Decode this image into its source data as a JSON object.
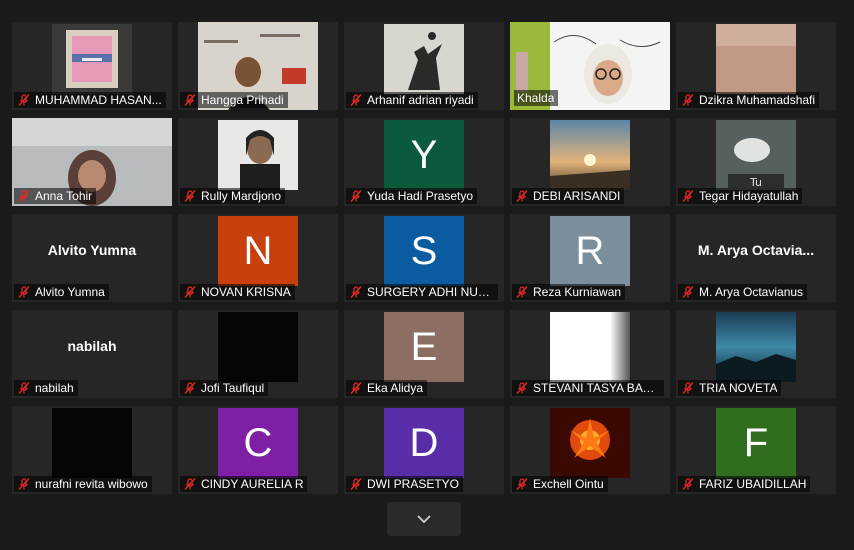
{
  "colors": {
    "background": "#1a1a1a",
    "tile": "#262626",
    "active_speaker_border": "#e4f08a",
    "muted_icon": "#e02828"
  },
  "participants": [
    {
      "name": "MUHAMMAD HASAN...",
      "muted": true,
      "media": "photo-art-icon"
    },
    {
      "name": "Hangga Prihadi",
      "muted": true,
      "media": "camera-video-icon"
    },
    {
      "name": "Arhanif adrian riyadi",
      "muted": true,
      "media": "photo-bird-icon"
    },
    {
      "name": "Khalda",
      "muted": false,
      "media": "camera-video-icon",
      "active": true
    },
    {
      "name": "Dzikra Muhamadshafi",
      "muted": true,
      "media": "blurred-photo-icon"
    },
    {
      "name": "Anna Tohir",
      "muted": true,
      "media": "camera-video-icon"
    },
    {
      "name": "Rully Mardjono",
      "muted": true,
      "media": "photo-portrait-icon"
    },
    {
      "name": "Yuda Hadi Prasetyo",
      "muted": true,
      "avatar_letter": "Y",
      "avatar_color": "#0c5a3c"
    },
    {
      "name": "DEBI ARISANDI",
      "muted": true,
      "media": "photo-sunset-icon"
    },
    {
      "name": "Tegar Hidayatullah",
      "muted": true,
      "media": "photo-anime-icon"
    },
    {
      "name": "Alvito Yumna",
      "muted": true,
      "center_name": "Alvito Yumna"
    },
    {
      "name": "NOVAN KRISNA",
      "muted": true,
      "avatar_letter": "N",
      "avatar_color": "#c8400c"
    },
    {
      "name": "SURGERY ADHI NUG...",
      "muted": true,
      "avatar_letter": "S",
      "avatar_color": "#0a5ba0"
    },
    {
      "name": "Reza Kurniawan",
      "muted": true,
      "avatar_letter": "R",
      "avatar_color": "#7a8e9b"
    },
    {
      "name": "M. Arya Octavianus",
      "muted": true,
      "center_name": "M. Arya Octavia..."
    },
    {
      "name": "nabilah",
      "muted": true,
      "center_name": "nabilah"
    },
    {
      "name": "Jofi Taufiqul",
      "muted": true,
      "media": "camera-off-black-icon"
    },
    {
      "name": "Eka Alidya",
      "muted": true,
      "avatar_letter": "E",
      "avatar_color": "#8c6e62"
    },
    {
      "name": "STEVANI TASYA BAWA...",
      "muted": true,
      "media": "white-frame-icon"
    },
    {
      "name": "TRIA NOVETA",
      "muted": true,
      "media": "photo-landscape-icon"
    },
    {
      "name": "nurafni revita wibowo",
      "muted": true,
      "media": "camera-off-black-icon"
    },
    {
      "name": "CINDY AURELIA R",
      "muted": true,
      "avatar_letter": "C",
      "avatar_color": "#7e1fa6"
    },
    {
      "name": "DWI PRASETYO",
      "muted": true,
      "avatar_letter": "D",
      "avatar_color": "#5a2da8"
    },
    {
      "name": "Exchell Ointu",
      "muted": true,
      "media": "photo-fire-flower-icon"
    },
    {
      "name": "FARIZ UBAIDILLAH",
      "muted": true,
      "avatar_letter": "F",
      "avatar_color": "#2e6e1e"
    }
  ],
  "pager": {
    "next_page_icon": "chevron-down-icon"
  }
}
